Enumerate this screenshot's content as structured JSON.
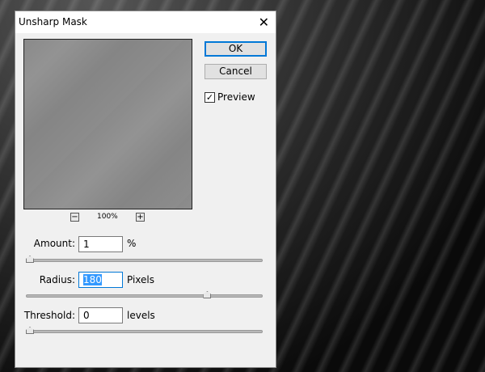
{
  "dialog": {
    "title": "Unsharp Mask",
    "ok": "OK",
    "cancel": "Cancel",
    "preview_label": "Preview",
    "preview_checked": true,
    "zoom_level": "100%",
    "minus": "−",
    "plus": "+",
    "close": "✕"
  },
  "fields": [
    {
      "label": "Amount:",
      "value": "1",
      "unit": "%",
      "slider": 0.0
    },
    {
      "label": "Radius:",
      "value": "180",
      "unit": "Pixels",
      "slider": 0.77
    },
    {
      "label": "Threshold:",
      "value": "0",
      "unit": "levels",
      "slider": 0.0
    }
  ]
}
